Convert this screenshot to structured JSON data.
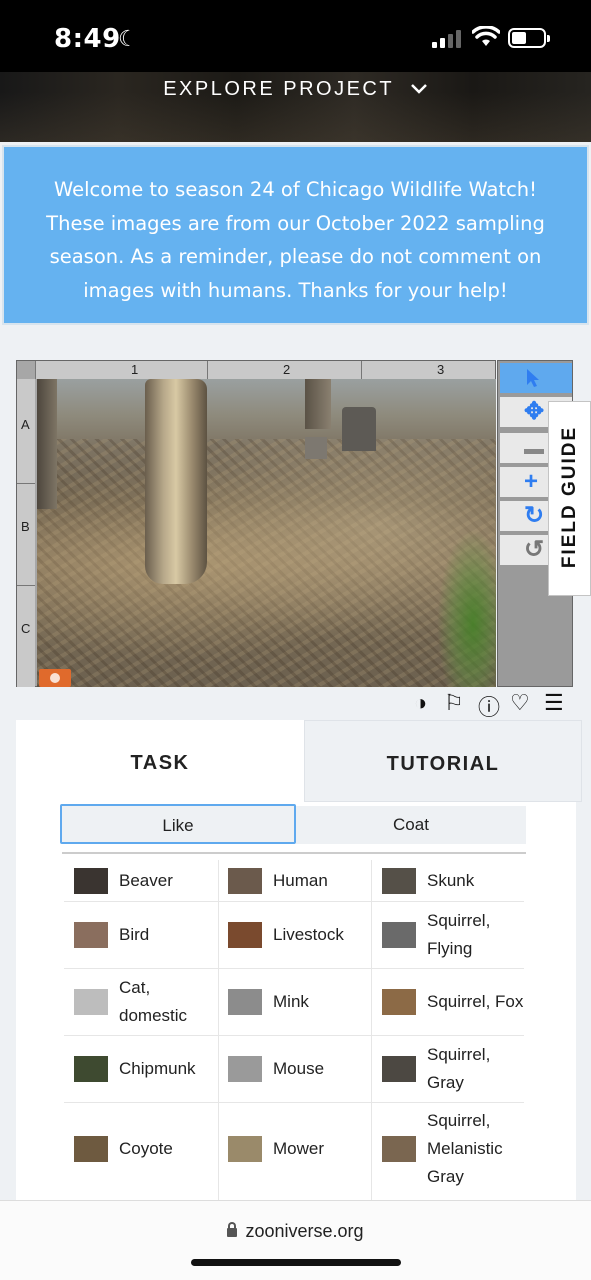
{
  "status_bar": {
    "time": "8:49",
    "moon": "☾"
  },
  "header": {
    "label": "EXPLORE PROJECT",
    "chevron": "⌄"
  },
  "announcement": {
    "text": "Welcome to season 24 of Chicago Wildlife Watch! These images are from our October 2022 sampling season. As a reminder, please do not comment on images with humans. Thanks for your help!"
  },
  "viewer": {
    "columns": [
      "1",
      "2",
      "3"
    ],
    "rows": [
      "A",
      "B",
      "C"
    ],
    "tools": [
      {
        "name": "pointer-icon",
        "glyph": "↖"
      },
      {
        "name": "move-icon",
        "glyph": "✥"
      },
      {
        "name": "zoom-out-icon",
        "glyph": "−"
      },
      {
        "name": "zoom-in-icon",
        "glyph": "+"
      },
      {
        "name": "rotate-icon",
        "glyph": "↻"
      },
      {
        "name": "reset-icon",
        "glyph": "↺"
      }
    ]
  },
  "field_guide": {
    "label": "FIELD GUIDE"
  },
  "meta_icons": {
    "contrast": "◑",
    "flag": "⚐",
    "info": "ⓘ",
    "heart": "♡",
    "collections": "☰"
  },
  "task_panel": {
    "tabs": {
      "task": "TASK",
      "tutorial": "TUTORIAL"
    },
    "subtabs": {
      "like": "Like",
      "coat": "Coat"
    },
    "species": [
      [
        {
          "label": "Beaver",
          "color": "#3a3430"
        },
        {
          "label": "Human",
          "color": "#6b5a4c"
        },
        {
          "label": "Skunk",
          "color": "#555048"
        }
      ],
      [
        {
          "label": "Bird",
          "color": "#8a6e5e"
        },
        {
          "label": "Livestock",
          "color": "#7a4a2e"
        },
        {
          "label": "Squirrel, Flying",
          "color": "#6a6a6a"
        }
      ],
      [
        {
          "label": "Cat, domestic",
          "color": "#bdbdbd"
        },
        {
          "label": "Mink",
          "color": "#8c8c8c"
        },
        {
          "label": "Squirrel, Fox",
          "color": "#8c6a46"
        }
      ],
      [
        {
          "label": "Chipmunk",
          "color": "#3e4a30"
        },
        {
          "label": "Mouse",
          "color": "#9a9a9a"
        },
        {
          "label": "Squirrel, Gray",
          "color": "#4c4842"
        }
      ],
      [
        {
          "label": "Coyote",
          "color": "#6e5a40"
        },
        {
          "label": "Mower",
          "color": "#9a8a6a"
        },
        {
          "label": "Squirrel, Melanistic Gray",
          "color": "#7a6650"
        }
      ]
    ]
  },
  "url_bar": {
    "url": "zooniverse.org"
  }
}
